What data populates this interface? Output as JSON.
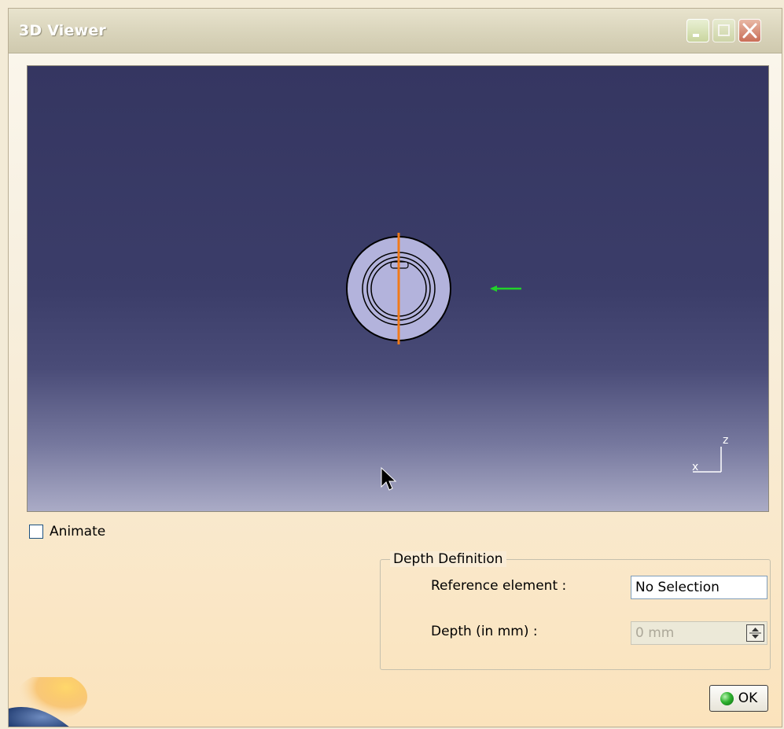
{
  "window": {
    "title": "3D Viewer"
  },
  "titlebar_buttons": {
    "minimize_icon": "minimize-icon",
    "maximize_icon": "maximize-icon",
    "close_icon": "close-icon"
  },
  "viewer": {
    "background_top": "#353661",
    "background_bottom": "#aaabc6",
    "part_fill": "#b3b3dc",
    "section_line_color": "#f07a1a",
    "direction_arrow_color": "#22d22a",
    "axis": {
      "vertical": "z",
      "horizontal": "x"
    }
  },
  "animate": {
    "label": "Animate",
    "checked": false
  },
  "depth_definition": {
    "legend": "Depth Definition",
    "reference_label": "Reference element :",
    "reference_value": "No Selection",
    "depth_label": "Depth (in mm) :",
    "depth_value": "0 mm"
  },
  "ok_button": {
    "label": "OK",
    "icon": "green-ball-icon"
  }
}
